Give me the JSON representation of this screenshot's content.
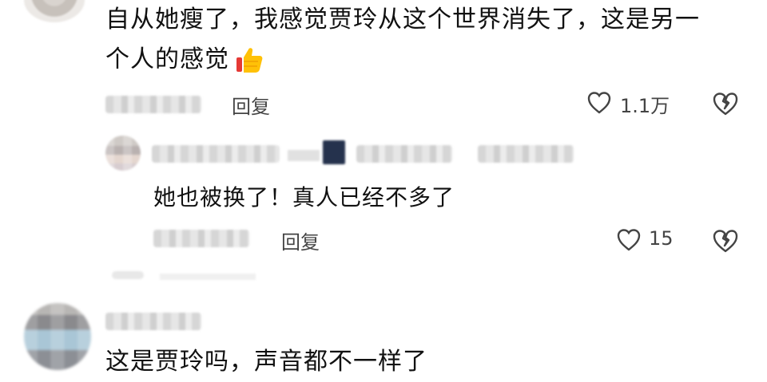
{
  "comments": [
    {
      "text_line1": "自从她瘦了，我感觉贾玲从这个世界消失了，这是另一",
      "text_line2": "个人的感觉",
      "reply_label": "回复",
      "likes": "1.1万"
    },
    {
      "text": "她也被换了！真人已经不多了",
      "reply_label": "回复",
      "likes": "15"
    },
    {
      "text": "这是贾玲吗，声音都不一样了"
    }
  ],
  "icons": {
    "thumbs_up": "thumbs-up-emoji",
    "like": "heart-outline-icon",
    "dislike": "broken-heart-icon"
  },
  "colors": {
    "text": "#111111",
    "secondary": "#444444",
    "thumb": "#f5b400"
  }
}
